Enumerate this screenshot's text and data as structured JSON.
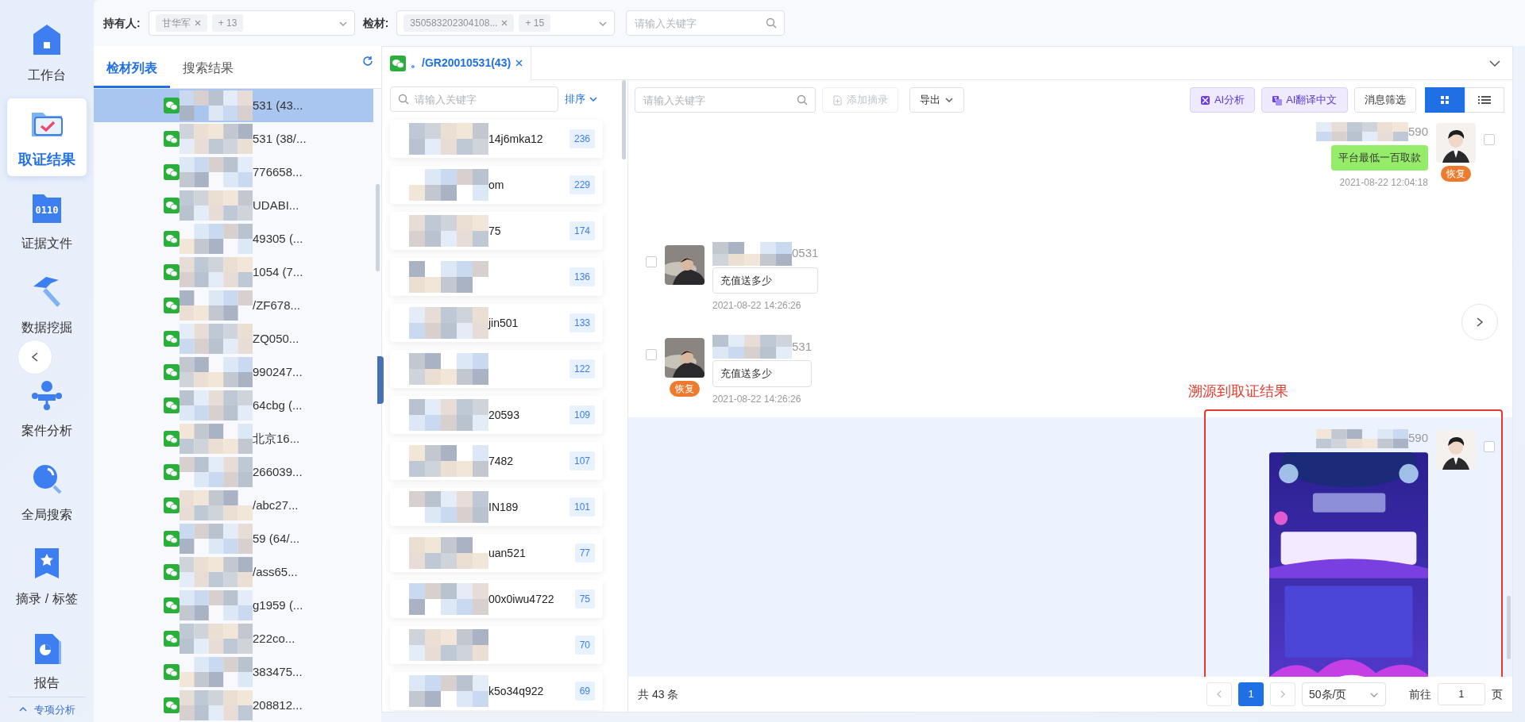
{
  "nav": {
    "items": [
      {
        "label": "工作台",
        "kind": "home",
        "selected": false
      },
      {
        "label": "取证结果",
        "kind": "evidence",
        "selected": true
      },
      {
        "label": "证据文件",
        "kind": "binary",
        "icon_text": "0110",
        "selected": false
      },
      {
        "label": "数据挖掘",
        "kind": "hammer",
        "selected": false
      },
      {
        "label": "案件分析",
        "kind": "network",
        "selected": false
      },
      {
        "label": "全局搜索",
        "kind": "search",
        "selected": false
      },
      {
        "label": "摘录 / 标签",
        "kind": "bookmark",
        "selected": false
      },
      {
        "label": "报告",
        "kind": "report",
        "selected": false
      }
    ],
    "footer": "专项分析"
  },
  "filters": [
    {
      "label": "持有人:",
      "tags": [
        "甘华军"
      ],
      "more": "+ 13"
    },
    {
      "label": "检材:",
      "tags": [
        "350583202304108..."
      ],
      "more": "+ 15"
    }
  ],
  "filter_search": {
    "placeholder": "请输入关键字"
  },
  "left_panel": {
    "tabs": [
      {
        "label": "检材列表",
        "selected": true
      },
      {
        "label": "搜索结果",
        "selected": false
      }
    ],
    "items": [
      {
        "text": "531 (43...",
        "selected": true
      },
      {
        "text": "531 (38/...",
        "selected": false
      },
      {
        "text": "776658...",
        "selected": false
      },
      {
        "text": "UDABI...",
        "selected": false
      },
      {
        "text": "49305 (...",
        "selected": false
      },
      {
        "text": "1054 (7...",
        "selected": false
      },
      {
        "text": "/ZF678...",
        "selected": false
      },
      {
        "text": "ZQ050...",
        "selected": false
      },
      {
        "text": "990247...",
        "selected": false
      },
      {
        "text": "64cbg (...",
        "selected": false
      },
      {
        "text": "北京16...",
        "selected": false
      },
      {
        "text": "266039...",
        "selected": false
      },
      {
        "text": "/abc27...",
        "selected": false
      },
      {
        "text": "59 (64/...",
        "selected": false
      },
      {
        "text": "/ass65...",
        "selected": false
      },
      {
        "text": "g1959 (...",
        "selected": false
      },
      {
        "text": "222co...",
        "selected": false
      },
      {
        "text": "383475...",
        "selected": false
      },
      {
        "text": "208812...",
        "selected": false
      }
    ]
  },
  "open_tab": {
    "label": "。/GR20010531(43)"
  },
  "contacts": {
    "search": {
      "placeholder": "请输入关键字"
    },
    "sort": "排序",
    "items": [
      {
        "text": "14j6mka12",
        "count": "236"
      },
      {
        "text": "om",
        "count": "229"
      },
      {
        "text": "75",
        "count": "174"
      },
      {
        "count": "136"
      },
      {
        "text": "jin501",
        "count": "133"
      },
      {
        "count": "122"
      },
      {
        "text": "20593",
        "count": "109"
      },
      {
        "text": "7482",
        "count": "107"
      },
      {
        "text": "IN189",
        "count": "101"
      },
      {
        "text": "uan521",
        "count": "77"
      },
      {
        "text": "00x0iwu4722",
        "count": "75"
      },
      {
        "count": "70"
      },
      {
        "text": "k5o34q922",
        "count": "69"
      }
    ]
  },
  "toolbar": {
    "search": {
      "placeholder": "请输入关键字"
    },
    "left_buttons": [
      {
        "label": "添加摘录",
        "kind": "add",
        "disabled": true
      },
      {
        "label": "导出",
        "kind": "dropdown",
        "disabled": false
      }
    ],
    "right_buttons": [
      {
        "label": "AI分析",
        "kind": "ai"
      },
      {
        "label": "AI翻译中文",
        "kind": "translate"
      },
      {
        "label": "消息筛选",
        "kind": "plain"
      }
    ],
    "views": [
      {
        "kind": "grid",
        "selected": true
      },
      {
        "kind": "list",
        "selected": false
      }
    ]
  },
  "messages": [
    {
      "outgoing": true,
      "name": "590",
      "kind": "text",
      "text": "平台最低一百取款",
      "time": "2021-08-22 12:04:18",
      "badge": "恢复",
      "checked": false,
      "highlighted": false
    },
    {
      "outgoing": false,
      "name": "0531",
      "kind": "text",
      "text": "充值送多少",
      "time": "2021-08-22 14:26:26",
      "checked": false,
      "highlighted": false
    },
    {
      "outgoing": false,
      "name": "531",
      "kind": "text",
      "text": "充值送多少",
      "time": "2021-08-22 14:26:26",
      "badge": "恢复",
      "checked": false,
      "highlighted": false
    },
    {
      "outgoing": true,
      "name": "590",
      "checked": false,
      "highlighted": true,
      "annotation": {
        "label": "溯源到取证结果"
      }
    }
  ],
  "pagination": {
    "total": "共 43 条",
    "pages": [
      {
        "label": "1",
        "selected": true
      }
    ],
    "page_size": "50条/页",
    "goto_label": "前往",
    "goto_value": "1",
    "page_suffix": "页"
  }
}
